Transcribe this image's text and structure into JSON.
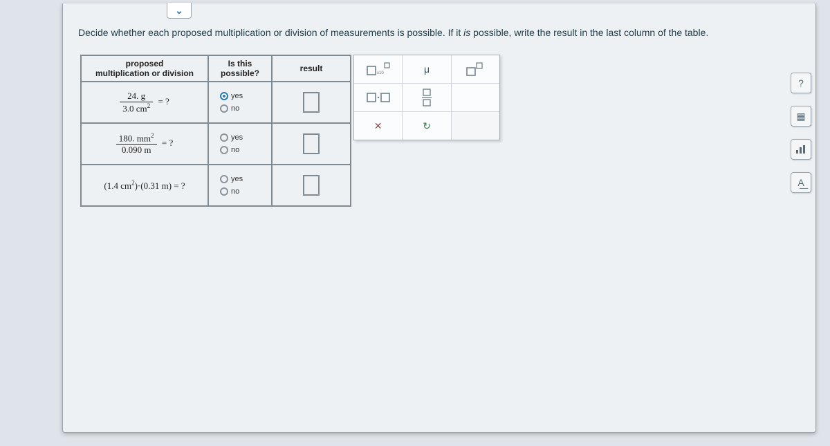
{
  "instruction": {
    "part1": "Decide whether each proposed multiplication or division of measurements is possible. If it ",
    "italic": "is",
    "part2": " possible, write the result in the last column of the table."
  },
  "table": {
    "headers": {
      "col1a": "proposed",
      "col1b": "multiplication or division",
      "col2a": "Is this",
      "col2b": "possible?",
      "col3": "result"
    },
    "rows": [
      {
        "frac_num": "24. g",
        "frac_den_val": "3.0 cm",
        "frac_den_sup": "2",
        "eq": "= ?",
        "yes": "yes",
        "no": "no",
        "yes_selected": true
      },
      {
        "frac_num_val": "180. mm",
        "frac_num_sup": "2",
        "frac_den": "0.090 m",
        "eq": "= ?",
        "yes": "yes",
        "no": "no",
        "yes_selected": false
      },
      {
        "expr_a": "1.4 cm",
        "expr_a_sup": "2",
        "expr_b": "0.31 m",
        "eq": " = ?",
        "yes": "yes",
        "no": "no",
        "yes_selected": false
      }
    ]
  },
  "palette": {
    "mu": "μ",
    "times": "✕",
    "redo": "↻"
  },
  "side": {
    "help": "?",
    "calc": "▦",
    "bars": "",
    "ref": "A͟"
  }
}
